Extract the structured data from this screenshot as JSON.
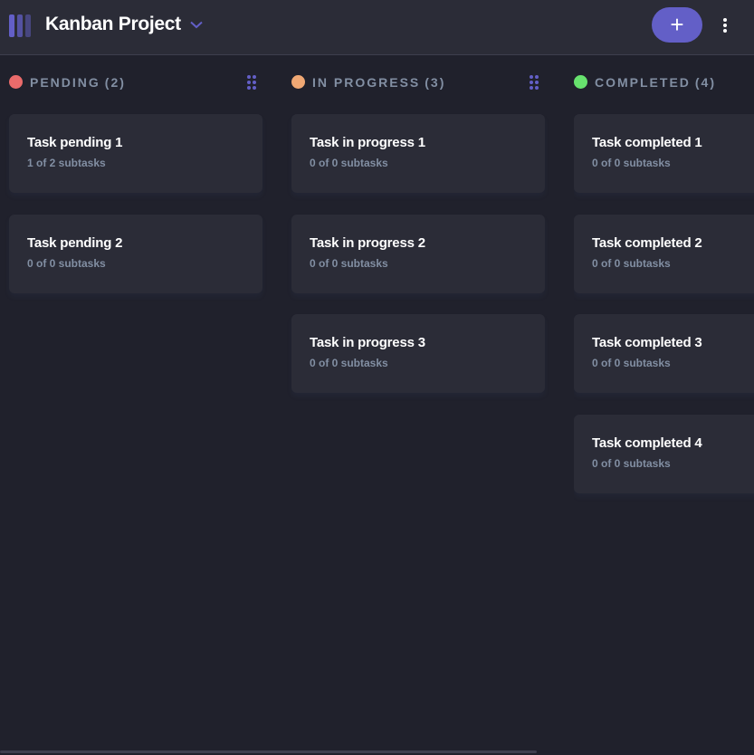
{
  "header": {
    "board_title": "Kanban Project",
    "add_label": "+"
  },
  "colors": {
    "accent": "#635fc7",
    "pending": "#ea6b6b",
    "in_progress": "#f0a874",
    "completed": "#67e26e"
  },
  "columns": [
    {
      "name": "PENDING",
      "count": "(2)",
      "color": "#ea6b6b",
      "tasks": [
        {
          "title": "Task pending 1",
          "subtasks": "1 of 2 subtasks"
        },
        {
          "title": "Task pending 2",
          "subtasks": "0 of 0 subtasks"
        }
      ]
    },
    {
      "name": "IN PROGRESS",
      "count": "(3)",
      "color": "#f0a874",
      "tasks": [
        {
          "title": "Task in progress 1",
          "subtasks": "0 of 0 subtasks"
        },
        {
          "title": "Task in progress 2",
          "subtasks": "0 of 0 subtasks"
        },
        {
          "title": "Task in progress 3",
          "subtasks": "0 of 0 subtasks"
        }
      ]
    },
    {
      "name": "COMPLETED",
      "count": "(4)",
      "color": "#67e26e",
      "tasks": [
        {
          "title": "Task completed 1",
          "subtasks": "0 of 0 subtasks"
        },
        {
          "title": "Task completed 2",
          "subtasks": "0 of 0 subtasks"
        },
        {
          "title": "Task completed 3",
          "subtasks": "0 of 0 subtasks"
        },
        {
          "title": "Task completed 4",
          "subtasks": "0 of 0 subtasks"
        }
      ]
    }
  ]
}
